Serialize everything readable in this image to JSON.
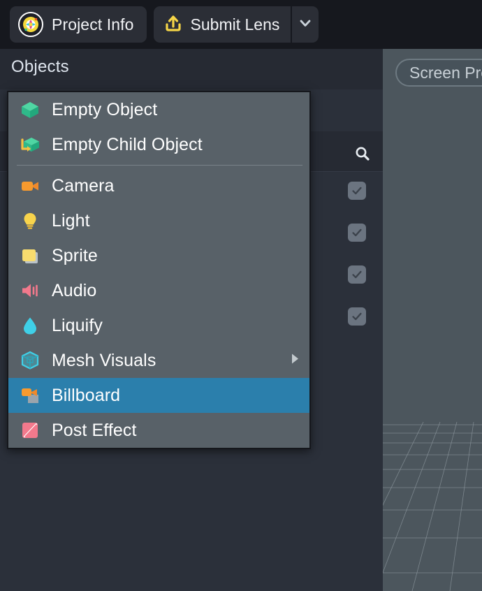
{
  "toolbar": {
    "project_info": {
      "label": "Project Info",
      "icon": "lens-studio-logo-icon"
    },
    "submit_lens": {
      "label": "Submit Lens",
      "icon": "upload-icon"
    },
    "submit_caret": {
      "icon": "chevron-down-icon"
    }
  },
  "panel": {
    "title": "Objects",
    "search": {
      "icon": "search-icon"
    },
    "rows": [
      {
        "checked": true,
        "check_icon": "check-icon"
      },
      {
        "checked": true,
        "check_icon": "check-icon"
      },
      {
        "checked": true,
        "check_icon": "check-icon"
      },
      {
        "checked": true,
        "check_icon": "check-icon"
      }
    ]
  },
  "viewport": {
    "screen_pill": {
      "label": "Screen Preview",
      "truncated": true
    },
    "grid": {
      "visible": true
    }
  },
  "context_menu": {
    "items": [
      {
        "label": "Empty Object",
        "icon": "empty-object-icon",
        "selected": false,
        "submenu": false
      },
      {
        "label": "Empty Child Object",
        "icon": "empty-child-object-icon",
        "selected": false,
        "submenu": false
      },
      {
        "label": "Camera",
        "icon": "camera-icon",
        "selected": false,
        "submenu": false
      },
      {
        "label": "Light",
        "icon": "light-bulb-icon",
        "selected": false,
        "submenu": false
      },
      {
        "label": "Sprite",
        "icon": "sprite-icon",
        "selected": false,
        "submenu": false
      },
      {
        "label": "Audio",
        "icon": "audio-speaker-icon",
        "selected": false,
        "submenu": false
      },
      {
        "label": "Liquify",
        "icon": "liquify-droplet-icon",
        "selected": false,
        "submenu": false
      },
      {
        "label": "Mesh Visuals",
        "icon": "mesh-cube-icon",
        "selected": false,
        "submenu": true
      },
      {
        "label": "Billboard",
        "icon": "billboard-icon",
        "selected": true,
        "submenu": false
      },
      {
        "label": "Post Effect",
        "icon": "post-effect-icon",
        "selected": false,
        "submenu": false
      }
    ],
    "separator_after_index": 1,
    "submenu_arrow_icon": "caret-right-icon"
  },
  "colors": {
    "toolbar_bg": "#16181e",
    "panel_bg": "#2b303a",
    "panel_header_bg": "#262a33",
    "menu_bg": "#586168",
    "menu_selected": "#2b7fac",
    "viewport_bg": "#4c565d",
    "accent_yellow": "#f5d547",
    "text_primary": "#ffffff"
  }
}
